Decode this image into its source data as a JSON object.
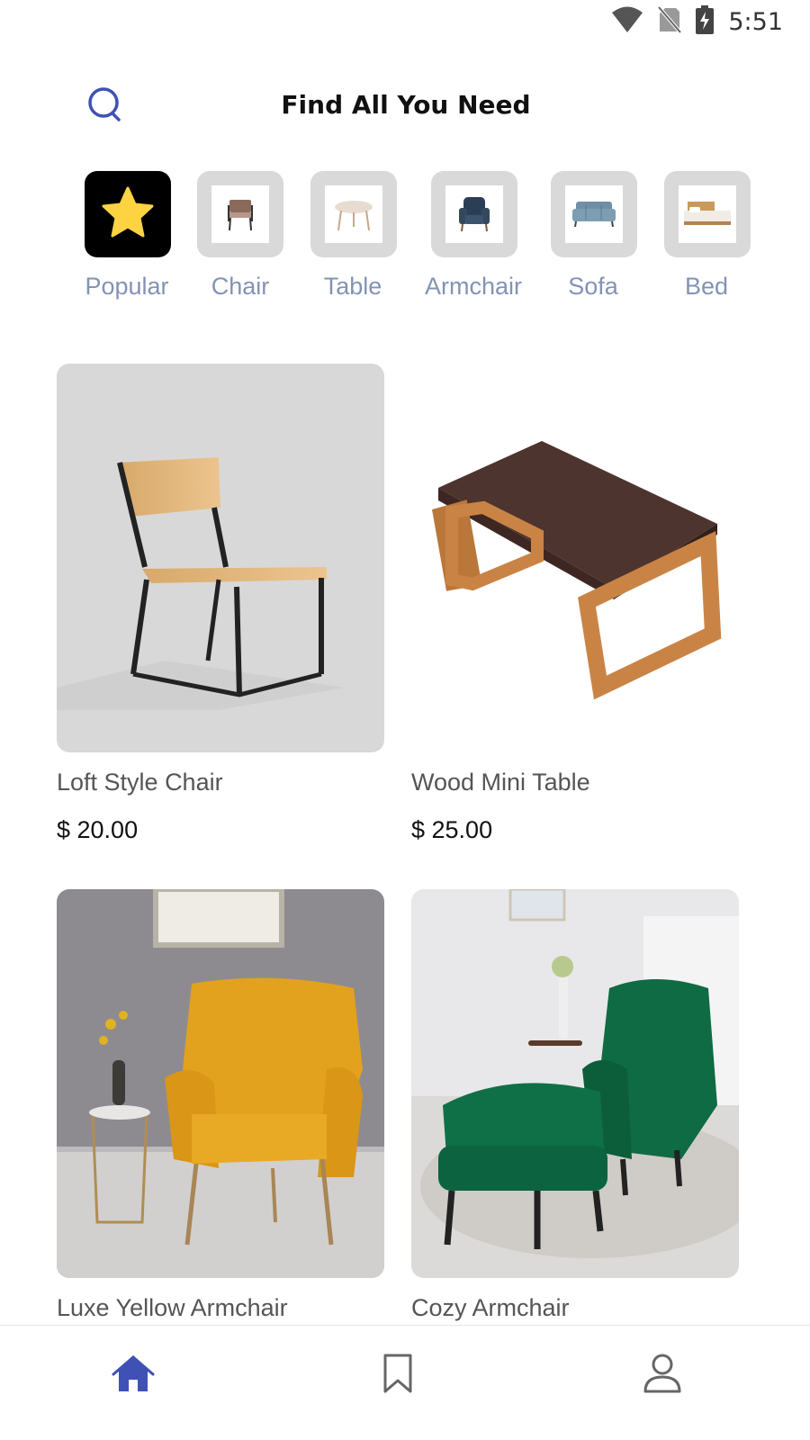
{
  "status_bar": {
    "time": "5:51",
    "icons": [
      "wifi-icon",
      "no-sim-icon",
      "battery-charging-icon"
    ]
  },
  "header": {
    "title": "Find All You Need",
    "search_icon": "search-icon"
  },
  "categories": [
    {
      "label": "Popular",
      "icon": "star-icon",
      "active": true
    },
    {
      "label": "Chair",
      "icon": "chair-thumbnail",
      "active": false
    },
    {
      "label": "Table",
      "icon": "table-thumbnail",
      "active": false
    },
    {
      "label": "Armchair",
      "icon": "armchair-thumbnail",
      "active": false
    },
    {
      "label": "Sofa",
      "icon": "sofa-thumbnail",
      "active": false
    },
    {
      "label": "Bed",
      "icon": "bed-thumbnail",
      "active": false
    }
  ],
  "products": [
    {
      "name": "Loft Style Chair",
      "price": "$ 20.00"
    },
    {
      "name": "Wood Mini Table",
      "price": "$ 25.00"
    },
    {
      "name": "Luxe Yellow Armchair",
      "price": ""
    },
    {
      "name": "Cozy Armchair",
      "price": ""
    }
  ],
  "bottom_nav": [
    {
      "icon": "home-icon",
      "active": true
    },
    {
      "icon": "bookmark-icon",
      "active": false
    },
    {
      "icon": "profile-icon",
      "active": false
    }
  ],
  "colors": {
    "accent": "#3f51b5",
    "category_label": "#8393b5",
    "category_bg": "#d9d9d9",
    "active_category_bg": "#000000",
    "star": "#fdd341"
  }
}
